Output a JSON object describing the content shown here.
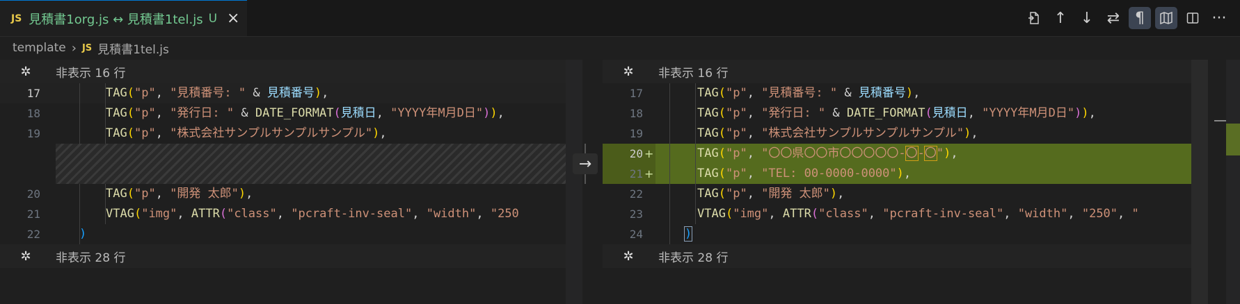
{
  "tab": {
    "badge": "JS",
    "title": "見積書1org.js ↔ 見積書1tel.js",
    "status": "U",
    "close": "×"
  },
  "toolbar": {
    "open_file_icon": "open-file-icon",
    "prev_change": "↑",
    "next_change": "↓",
    "swap": "⇄",
    "whitespace": "¶",
    "inline_view": "🕮",
    "split": "◫",
    "more": "···"
  },
  "breadcrumb": {
    "folder": "template",
    "sep": "›",
    "badge": "JS",
    "file": "見積書1tel.js"
  },
  "colors": {
    "added_bg": "#556b1e",
    "accent": "#0078d4",
    "js_badge": "#e8c94a",
    "modified_text": "#73c991"
  },
  "left": {
    "hidden_top": "非表示 16 行",
    "hidden_bottom": "非表示 28 行",
    "lines": [
      {
        "num": "17",
        "text": "TAG(\"p\", \"見積番号: \" & 見積番号),"
      },
      {
        "num": "18",
        "text": "TAG(\"p\", \"発行日: \" & DATE_FORMAT(見積日, \"YYYY年M月D日\")),"
      },
      {
        "num": "19",
        "text": "TAG(\"p\", \"株式会社サンプルサンプルサンプル\"),"
      },
      {
        "num": "20",
        "text": "TAG(\"p\", \"開発 太郎\"),"
      },
      {
        "num": "21",
        "text": "VTAG(\"img\", ATTR(\"class\", \"pcraft-inv-seal\", \"width\", \"250"
      },
      {
        "num": "22",
        "text": ")"
      }
    ]
  },
  "right": {
    "hidden_top": "非表示 16 行",
    "hidden_bottom": "非表示 28 行",
    "lines": [
      {
        "num": "17",
        "mark": "",
        "text": "TAG(\"p\", \"見積番号: \" & 見積番号),"
      },
      {
        "num": "18",
        "mark": "",
        "text": "TAG(\"p\", \"発行日: \" & DATE_FORMAT(見積日, \"YYYY年M月D日\")),"
      },
      {
        "num": "19",
        "mark": "",
        "text": "TAG(\"p\", \"株式会社サンプルサンプルサンプル\"),"
      },
      {
        "num": "20",
        "mark": "+",
        "text": "TAG(\"p\", \"〇〇県〇〇市〇〇〇〇〇-〇-〇\"),"
      },
      {
        "num": "21",
        "mark": "+",
        "text": "TAG(\"p\", \"TEL: 00-0000-0000\"),"
      },
      {
        "num": "22",
        "mark": "",
        "text": "TAG(\"p\", \"開発 太郎\"),"
      },
      {
        "num": "23",
        "mark": "",
        "text": "VTAG(\"img\", ATTR(\"class\", \"pcraft-inv-seal\", \"width\", \"250\", \""
      },
      {
        "num": "24",
        "mark": "",
        "text": ")"
      }
    ]
  },
  "revert_label": "→"
}
